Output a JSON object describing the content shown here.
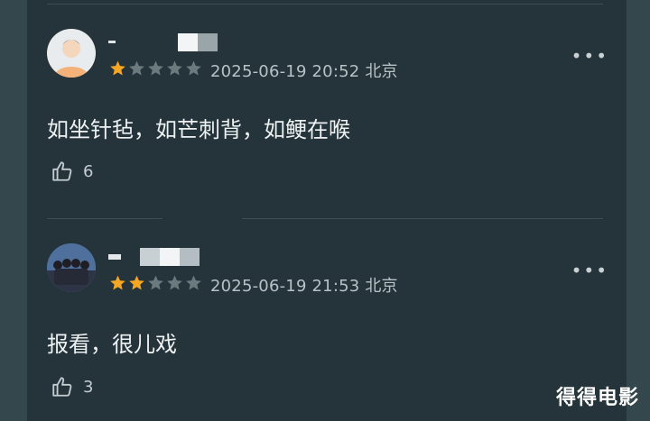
{
  "comments": [
    {
      "rating": 1,
      "date": "2025-06-19 20:52 北京",
      "text": "如坐针毡，如芒刺背，如鲠在喉",
      "likes": "6",
      "more_label": "•••"
    },
    {
      "rating": 2,
      "date": "2025-06-19 21:53 北京",
      "text": "报看，很儿戏",
      "likes": "3",
      "more_label": "•••"
    }
  ],
  "watermark": "得得电影",
  "colors": {
    "star_active": "#f5a623",
    "star_inactive": "#6b7a7f",
    "panel_bg": "#24343a"
  },
  "icons": {
    "like": "thumbs-up-icon",
    "more": "more-dots-icon",
    "star": "star-icon"
  }
}
